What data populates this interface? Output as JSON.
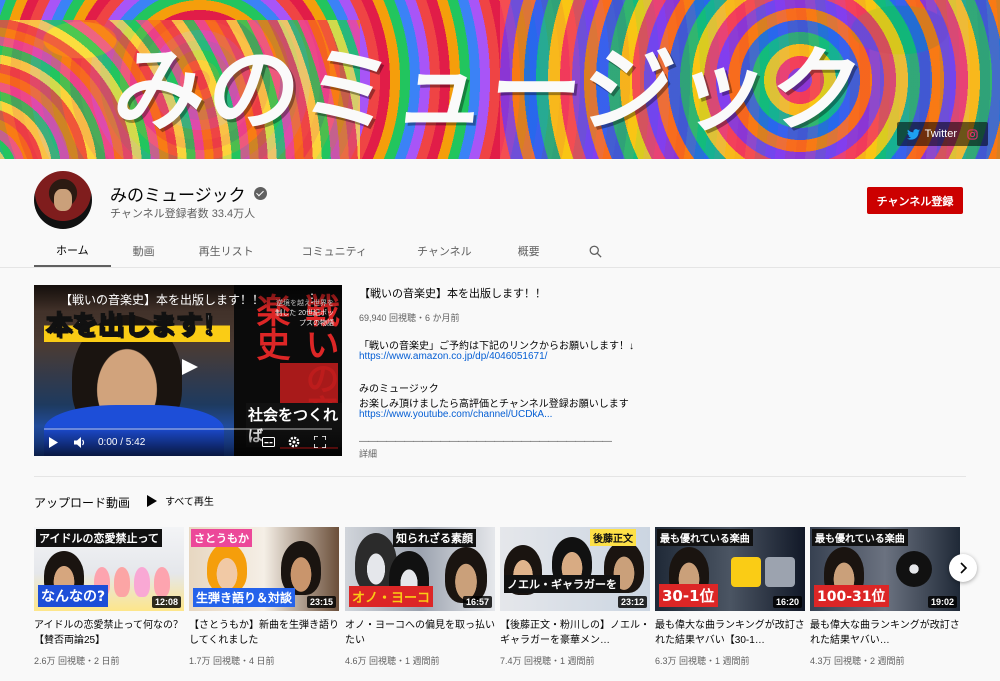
{
  "banner": {
    "title": "みのミュージック",
    "twitter_label": "Twitter"
  },
  "channel": {
    "name": "みのミュージック",
    "subscribers": "チャンネル登録者数 33.4万人",
    "subscribe_label": "チャンネル登録"
  },
  "tabs": [
    {
      "label": "ホーム"
    },
    {
      "label": "動画"
    },
    {
      "label": "再生リスト"
    },
    {
      "label": "コミュニティ"
    },
    {
      "label": "チャンネル"
    },
    {
      "label": "概要"
    }
  ],
  "featured": {
    "video_title_overlay": "【戦いの音楽史】本を出版します！！",
    "caption": "本を出します！",
    "book_title": "戦いの音楽史",
    "book_sub": "逆境を越え 世界を制した 20世紀ポップスの物語",
    "book_band": "社会をつくれば",
    "time": "0:00 / 5:42",
    "title": "【戦いの音楽史】本を出版します！！",
    "meta": "69,940 回視聴・6 か月前",
    "desc1": "「戦いの音楽史」ご予約は下記のリンクからお願いします！↓",
    "link1": "https://www.amazon.co.jp/dp/4046051671/",
    "desc2": "みのミュージック",
    "desc3": "お楽しみ頂けましたら高評価とチャンネル登録お願いします",
    "link2": "https://www.youtube.com/channel/UCDkA...",
    "dashes": "――――――――――――――――――――――――――――",
    "more": "詳細"
  },
  "uploads": {
    "title": "アップロード動画",
    "play_all": "すべて再生",
    "videos": [
      {
        "title": "アイドルの恋愛禁止って何なの？【賛否両論25】",
        "meta": "2.6万 回視聴・2 日前",
        "duration": "12:08",
        "cap1": "アイドルの恋愛禁止って",
        "cap2": "なんなの?"
      },
      {
        "title": "【さとうもか】新曲を生弾き語りしてくれました",
        "meta": "1.7万 回視聴・4 日前",
        "duration": "23:15",
        "cap1": "さとうもか",
        "cap2": "生弾き語り＆対談"
      },
      {
        "title": "オノ・ヨーコへの偏見を取っ払いたい",
        "meta": "4.6万 回視聴・1 週間前",
        "duration": "16:57",
        "cap1": "知られざる素顔",
        "cap2": "オノ・ヨーコ"
      },
      {
        "title": "【後藤正文・粉川しの】ノエル・ギャラガーを豪華メン…",
        "meta": "7.4万 回視聴・1 週間前",
        "duration": "23:12",
        "cap1": "後藤正文",
        "cap2": "ノエル・ギャラガーを"
      },
      {
        "title": "最も偉大な曲ランキングが改訂された結果ヤバい【30-1…",
        "meta": "6.3万 回視聴・1 週間前",
        "duration": "16:20",
        "cap1": "最も優れている楽曲",
        "cap2": "30-1位"
      },
      {
        "title": "最も偉大な曲ランキングが改訂された結果ヤバい…",
        "meta": "4.3万 回視聴・2 週間前",
        "duration": "19:02",
        "cap1": "最も優れている楽曲",
        "cap2": "100-31位"
      }
    ]
  },
  "colors": {
    "subscribe_red": "#cc0000",
    "link_blue": "#065fd4"
  }
}
